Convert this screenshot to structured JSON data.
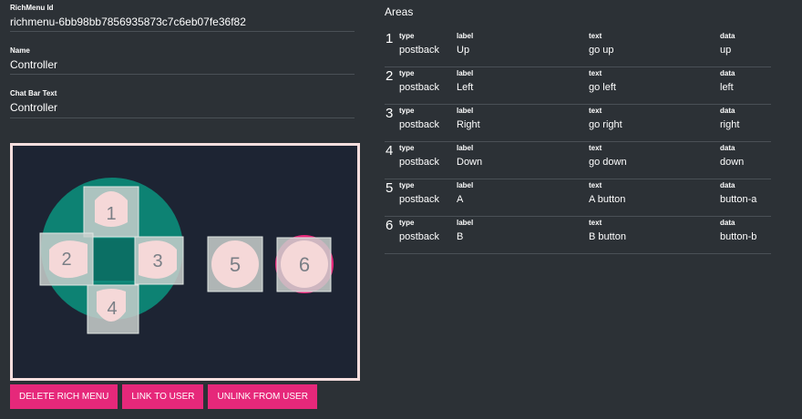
{
  "richmenu": {
    "id_label": "RichMenu Id",
    "id_value": "richmenu-6bb98bb7856935873c7c6eb07fe36f82",
    "name_label": "Name",
    "name_value": "Controller",
    "chatbar_label": "Chat Bar Text",
    "chatbar_value": "Controller"
  },
  "preview": {
    "pads": [
      {
        "number": "1"
      },
      {
        "number": "2"
      },
      {
        "number": "3"
      },
      {
        "number": "4"
      },
      {
        "number": "5"
      },
      {
        "number": "6"
      }
    ],
    "colors": {
      "background": "#1d2433",
      "teal": "#0d8273",
      "pad": "#f5d8d8",
      "accent": "#e6287a",
      "frame": "#f7dede"
    }
  },
  "buttons": {
    "delete": "DELETE RICH MENU",
    "link": "LINK TO USER",
    "unlink": "UNLINK FROM USER"
  },
  "areas": {
    "title": "Areas",
    "col_type": "type",
    "col_label": "label",
    "col_text": "text",
    "col_data": "data",
    "rows": [
      {
        "num": "1",
        "type": "postback",
        "label": "Up",
        "text": "go up",
        "data": "up"
      },
      {
        "num": "2",
        "type": "postback",
        "label": "Left",
        "text": "go left",
        "data": "left"
      },
      {
        "num": "3",
        "type": "postback",
        "label": "Right",
        "text": "go right",
        "data": "right"
      },
      {
        "num": "4",
        "type": "postback",
        "label": "Down",
        "text": "go down",
        "data": "down"
      },
      {
        "num": "5",
        "type": "postback",
        "label": "A",
        "text": "A button",
        "data": "button-a"
      },
      {
        "num": "6",
        "type": "postback",
        "label": "B",
        "text": "B button",
        "data": "button-b"
      }
    ]
  }
}
